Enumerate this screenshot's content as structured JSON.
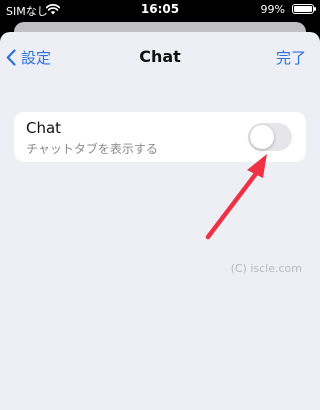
{
  "status_bar": {
    "carrier": "SIMなし",
    "time": "16:05",
    "battery_percent": "99%",
    "battery_level": 0.99
  },
  "nav": {
    "back_label": "設定",
    "title": "Chat",
    "done_label": "完了"
  },
  "setting": {
    "title": "Chat",
    "subtitle": "チャットタブを表示する",
    "toggle_on": false
  },
  "watermark": "(C) iscle.com",
  "colors": {
    "accent": "#2a6ee0",
    "annotation_arrow": "#ee3246",
    "sheet_background": "#eeeff4"
  },
  "icons": {
    "back": "chevron-left-icon",
    "wifi": "wifi-icon",
    "battery": "battery-icon"
  }
}
